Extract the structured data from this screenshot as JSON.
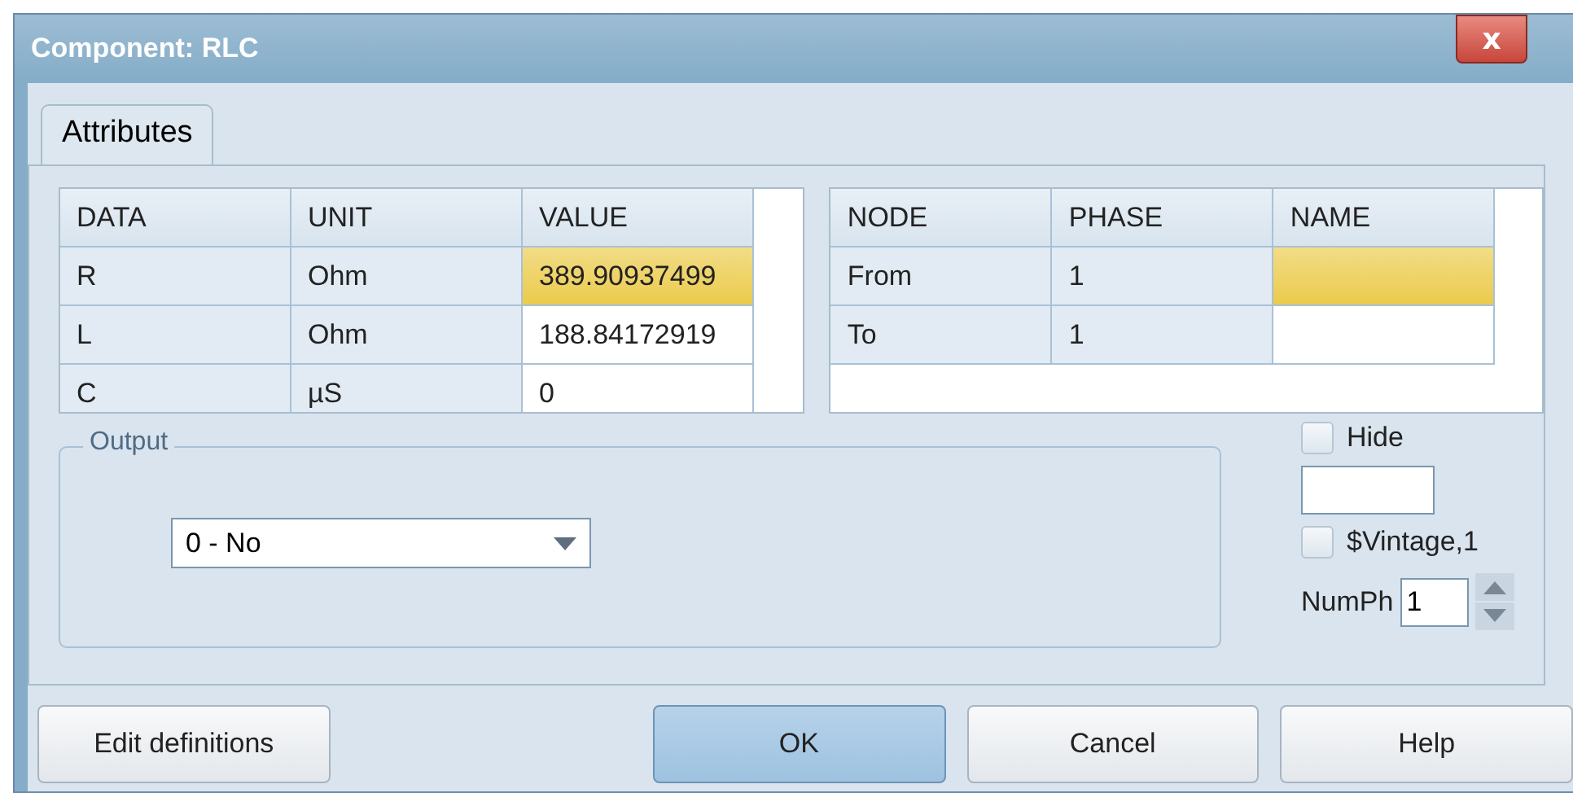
{
  "window": {
    "title": "Component: RLC",
    "close": "x"
  },
  "tabs": [
    {
      "label": "Attributes",
      "selected": true
    }
  ],
  "data_table": {
    "columns": [
      "DATA",
      "UNIT",
      "VALUE"
    ],
    "rows": [
      [
        {
          "text": "R",
          "selected": false
        },
        {
          "text": "Ohm",
          "selected": false
        },
        {
          "text": "389.90937499",
          "selected": true
        }
      ],
      [
        {
          "text": "L",
          "selected": false
        },
        {
          "text": "Ohm",
          "selected": false
        },
        {
          "text": "188.84172919",
          "selected": false
        }
      ],
      [
        {
          "text": "C",
          "selected": false
        },
        {
          "text": "µS",
          "selected": false
        },
        {
          "text": "0",
          "selected": false
        }
      ]
    ]
  },
  "node_table": {
    "columns": [
      "NODE",
      "PHASE",
      "NAME"
    ],
    "rows": [
      [
        {
          "text": "From",
          "selected": false
        },
        {
          "text": "1",
          "selected": false
        },
        {
          "selected": true
        }
      ],
      [
        {
          "text": "To",
          "selected": false
        },
        {
          "text": "1",
          "selected": false
        },
        {
          "selected": false
        }
      ]
    ]
  },
  "output": {
    "label": "Output",
    "value": "0 - No"
  },
  "hide": {
    "label": "Hide",
    "checked": false
  },
  "vintage": {
    "label": "$Vintage,1",
    "checked": false
  },
  "numph": {
    "label": "NumPh",
    "value": "1"
  },
  "buttons": [
    {
      "label": "Edit definitions",
      "default": false
    },
    {
      "label": "OK",
      "default": true
    },
    {
      "label": "Cancel",
      "default": false
    },
    {
      "label": "Help",
      "default": false
    }
  ]
}
